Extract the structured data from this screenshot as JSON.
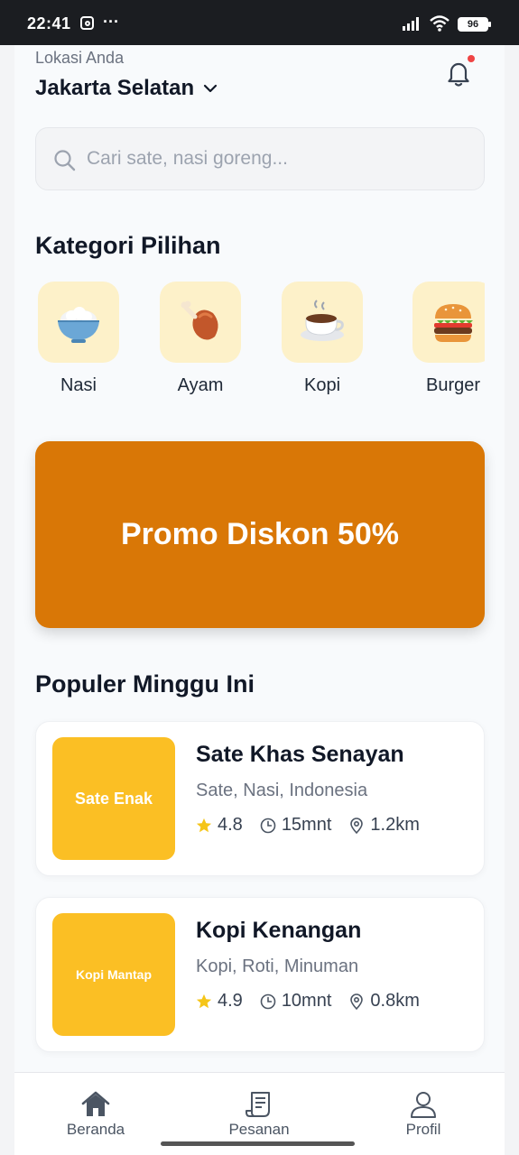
{
  "status_bar": {
    "time": "22:41",
    "dots": "···",
    "battery": "96"
  },
  "header": {
    "location_label": "Lokasi Anda",
    "location_value": "Jakarta Selatan"
  },
  "search": {
    "placeholder": "Cari sate, nasi goreng..."
  },
  "categories": {
    "title": "Kategori Pilihan",
    "items": [
      {
        "label": "Nasi",
        "icon": "rice-bowl-icon"
      },
      {
        "label": "Ayam",
        "icon": "chicken-leg-icon"
      },
      {
        "label": "Kopi",
        "icon": "coffee-cup-icon"
      },
      {
        "label": "Burger",
        "icon": "burger-icon"
      }
    ]
  },
  "promo": {
    "text": "Promo Diskon 50%",
    "color": "#d97706"
  },
  "popular": {
    "title": "Populer Minggu Ini",
    "items": [
      {
        "image_text": "Sate Enak",
        "name": "Sate Khas Senayan",
        "tags": "Sate, Nasi, Indonesia",
        "rating": "4.8",
        "time": "15mnt",
        "distance": "1.2km"
      },
      {
        "image_text": "Kopi Mantap",
        "name": "Kopi Kenangan",
        "tags": "Kopi, Roti, Minuman",
        "rating": "4.9",
        "time": "10mnt",
        "distance": "0.8km"
      }
    ]
  },
  "tabbar": {
    "items": [
      {
        "label": "Beranda",
        "icon": "home-icon"
      },
      {
        "label": "Pesanan",
        "icon": "receipt-icon"
      },
      {
        "label": "Profil",
        "icon": "user-icon"
      }
    ]
  },
  "colors": {
    "accent": "#fbbf24",
    "promo": "#d97706",
    "star": "#f5c518"
  }
}
